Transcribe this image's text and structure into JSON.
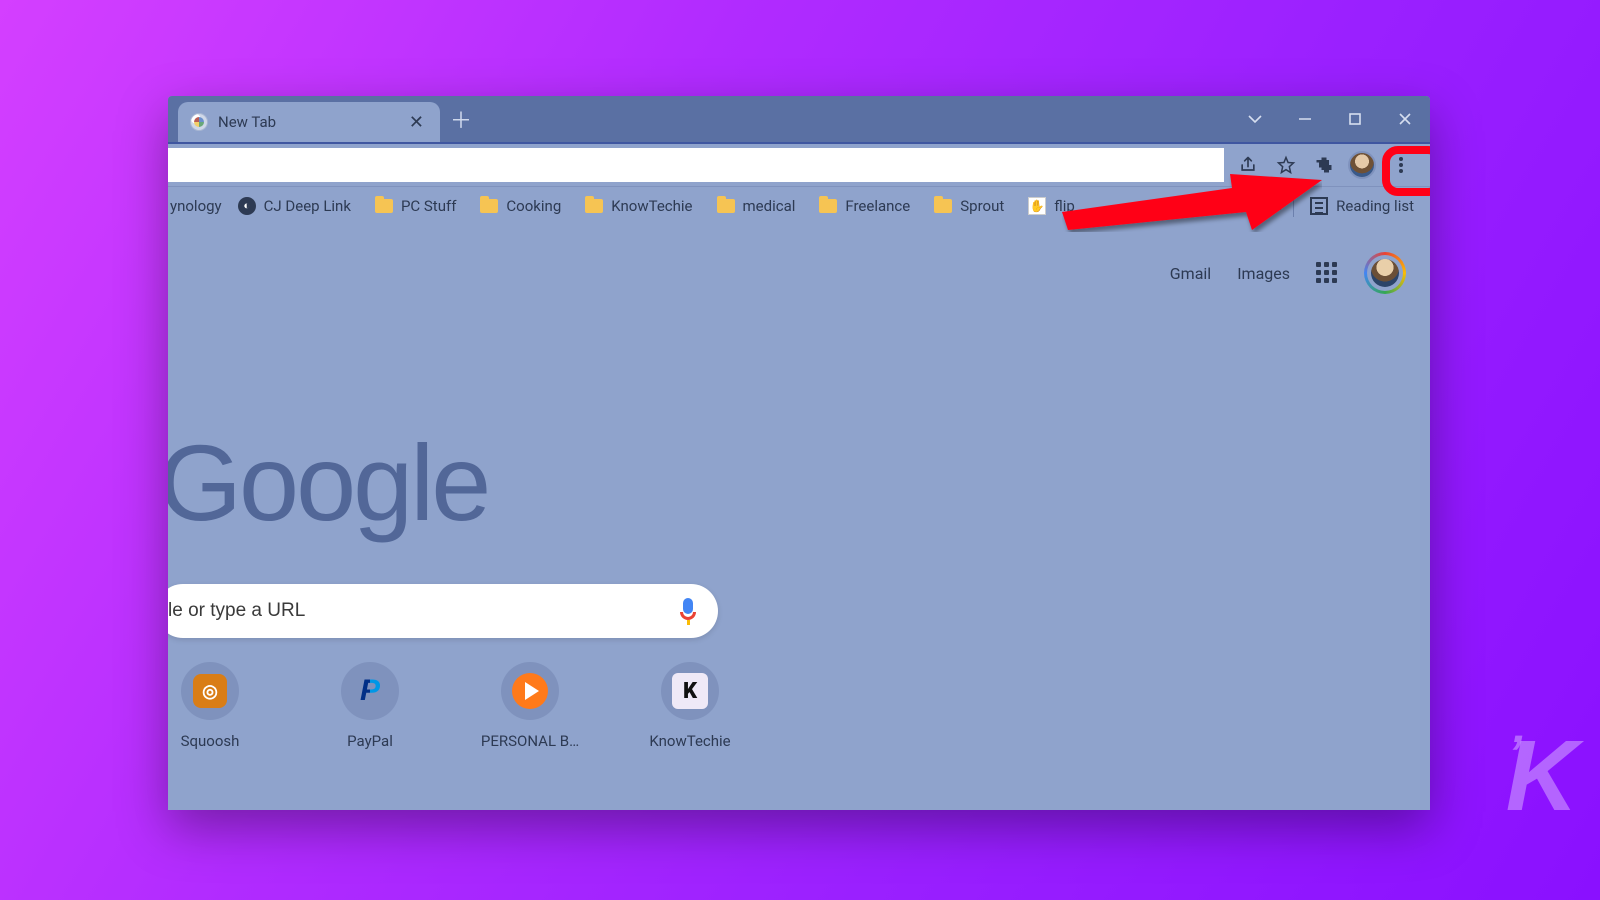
{
  "tab": {
    "title": "New Tab"
  },
  "bookmarks": {
    "partial_first": "ynology",
    "items": [
      {
        "type": "link",
        "label": "CJ Deep Link"
      },
      {
        "type": "folder",
        "label": "PC Stuff"
      },
      {
        "type": "folder",
        "label": "Cooking"
      },
      {
        "type": "folder",
        "label": "KnowTechie"
      },
      {
        "type": "folder",
        "label": "medical"
      },
      {
        "type": "folder",
        "label": "Freelance"
      },
      {
        "type": "folder",
        "label": "Sprout"
      },
      {
        "type": "flip",
        "label": "flip"
      }
    ],
    "reading_list": "Reading list"
  },
  "toplinks": {
    "gmail": "Gmail",
    "images": "Images"
  },
  "logo_text": "Google",
  "search": {
    "value": "le or type a URL"
  },
  "shortcuts": [
    {
      "label": "Squoosh",
      "kind": "sq"
    },
    {
      "label": "PayPal",
      "kind": "pp"
    },
    {
      "label": "PERSONAL B…",
      "kind": "pb"
    },
    {
      "label": "KnowTechie",
      "kind": "kt"
    }
  ],
  "watermark": "K"
}
